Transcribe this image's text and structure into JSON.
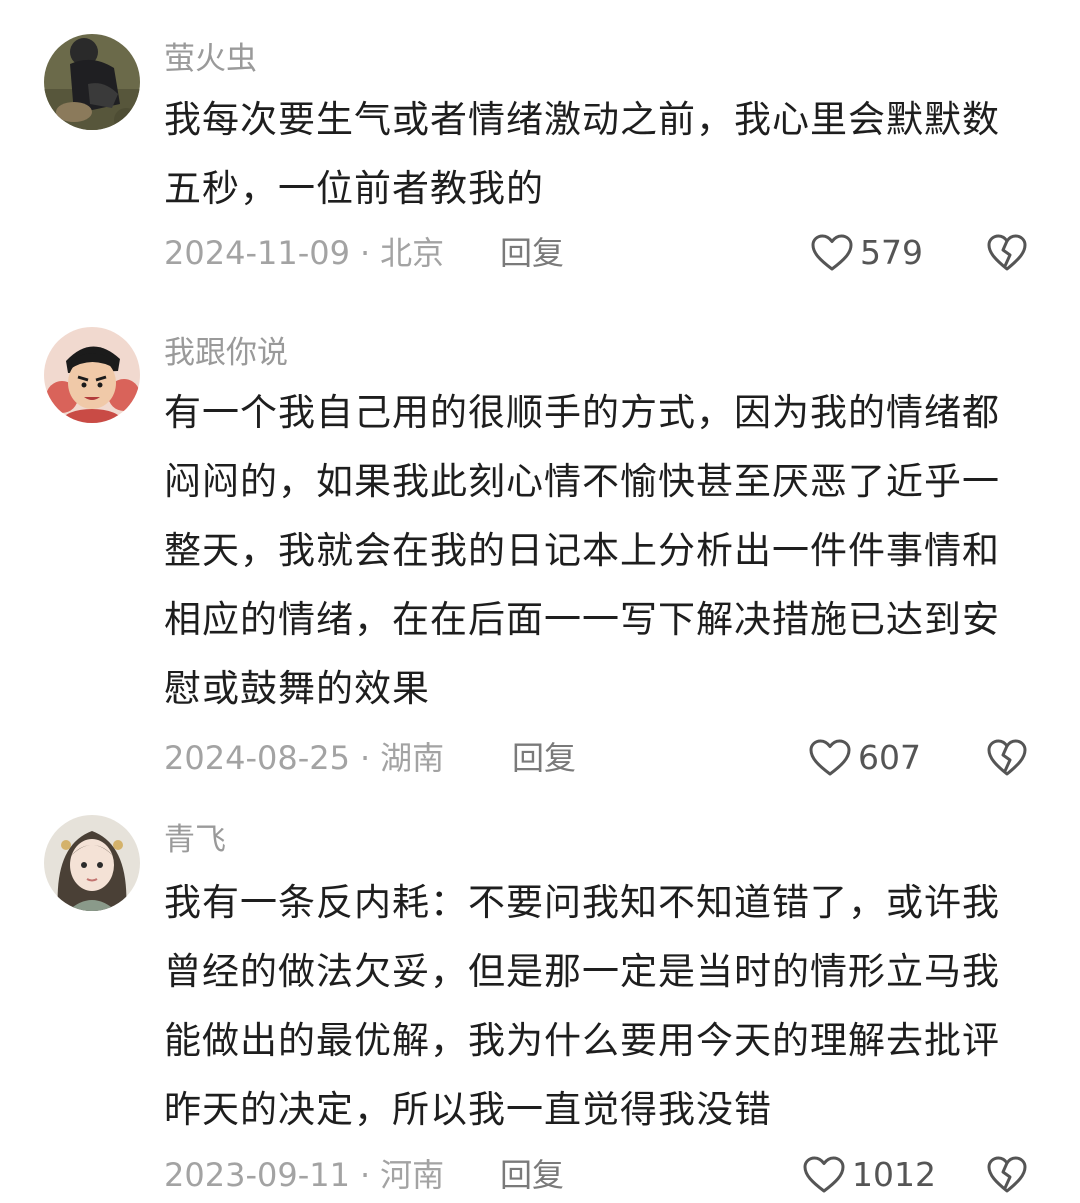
{
  "comments": [
    {
      "username": "萤火虫",
      "text": "我每次要生气或者情绪激动之前，我心里会默默数五秒，一位前者教我的",
      "date": "2024-11-09",
      "location": "北京",
      "reply_label": "回复",
      "likes": "579"
    },
    {
      "username": "我跟你说",
      "text": "有一个我自己用的很顺手的方式，因为我的情绪都闷闷的，如果我此刻心情不愉快甚至厌恶了近乎一整天，我就会在我的日记本上分析出一件件事情和相应的情绪，在在后面一一写下解决措施已达到安慰或鼓舞的效果",
      "date": "2024-08-25",
      "location": "湖南",
      "reply_label": "回复",
      "likes": "607"
    },
    {
      "username": "青飞",
      "text": "我有一条反内耗：不要问我知不知道错了，或许我曾经的做法欠妥，但是那一定是当时的情形立马我能做出的最优解，我为什么要用今天的理解去批评昨天的决定，所以我一直觉得我没错",
      "date": "2023-09-11",
      "location": "河南",
      "reply_label": "回复",
      "likes": "1012"
    }
  ],
  "separator": "·",
  "icons": {
    "like": "heart-outline-icon",
    "dislike": "broken-heart-icon",
    "avatar_1": "avatar-photo-person",
    "avatar_2": "avatar-cartoon-boy",
    "avatar_3": "avatar-illustrated-girl"
  },
  "colors": {
    "username": "#9a9a9a",
    "meta": "#a3a3a3",
    "text": "#1e1e1e",
    "icon": "#555555"
  }
}
